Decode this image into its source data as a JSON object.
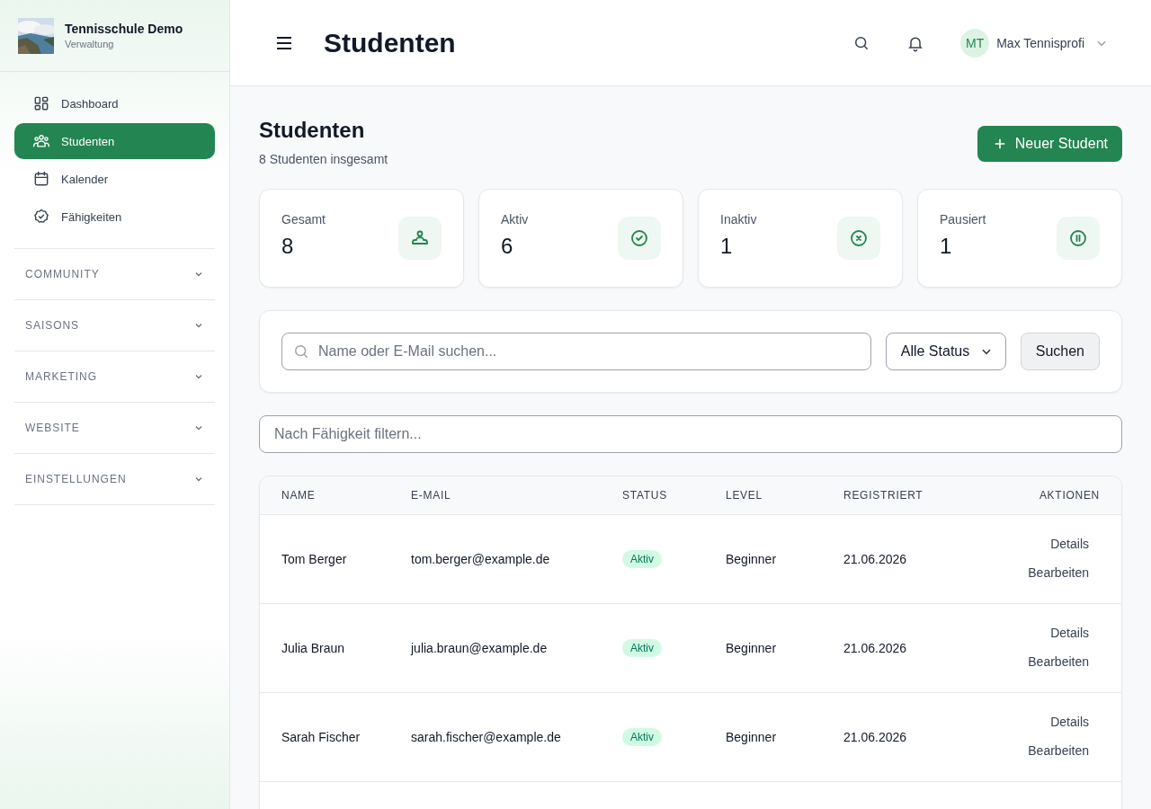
{
  "brand": {
    "title": "Tennisschule Demo",
    "subtitle": "Verwaltung"
  },
  "nav": [
    {
      "label": "Dashboard",
      "kind": "grid",
      "selected": false
    },
    {
      "label": "Studenten",
      "kind": "users",
      "selected": true
    },
    {
      "label": "Kalender",
      "kind": "calendar",
      "selected": false
    },
    {
      "label": "Fähigkeiten",
      "kind": "badge",
      "selected": false
    }
  ],
  "sections": [
    {
      "label": "COMMUNITY",
      "expanded": false
    },
    {
      "label": "SAISONS",
      "expanded": false
    },
    {
      "label": "MARKETING",
      "expanded": false
    },
    {
      "label": "WEBSITE",
      "expanded": false
    },
    {
      "label": "EINSTELLUNGEN",
      "expanded": false
    }
  ],
  "header": {
    "title": "Studenten",
    "user": {
      "initials": "MT",
      "name": "Max Tennisprofi"
    }
  },
  "page": {
    "title": "Studenten",
    "subtitle": "8 Studenten insgesamt",
    "new_button": "Neuer Student"
  },
  "stats": [
    {
      "label": "Gesamt",
      "value": "8",
      "kind": "total"
    },
    {
      "label": "Aktiv",
      "value": "6",
      "kind": "active"
    },
    {
      "label": "Inaktiv",
      "value": "1",
      "kind": "inactive"
    },
    {
      "label": "Pausiert",
      "value": "1",
      "kind": "paused"
    }
  ],
  "search": {
    "placeholder": "Name oder E-Mail suchen...",
    "status_select": "Alle Status",
    "button": "Suchen"
  },
  "skill_filter": {
    "placeholder": "Nach Fähigkeit filtern..."
  },
  "table": {
    "columns": [
      "NAME",
      "E-MAIL",
      "STATUS",
      "LEVEL",
      "REGISTRIERT",
      "AKTIONEN"
    ],
    "rows": [
      {
        "name": "Tom Berger",
        "email": "tom.berger@example.de",
        "status": "Aktiv",
        "level": "Beginner",
        "registered": "21.06.2026",
        "actions": [
          "Details",
          "Bearbeiten"
        ]
      },
      {
        "name": "Julia Braun",
        "email": "julia.braun@example.de",
        "status": "Aktiv",
        "level": "Beginner",
        "registered": "21.06.2026",
        "actions": [
          "Details",
          "Bearbeiten"
        ]
      },
      {
        "name": "Sarah Fischer",
        "email": "sarah.fischer@example.de",
        "status": "Aktiv",
        "level": "Beginner",
        "registered": "21.06.2026",
        "actions": [
          "Details",
          "Bearbeiten"
        ]
      }
    ]
  }
}
